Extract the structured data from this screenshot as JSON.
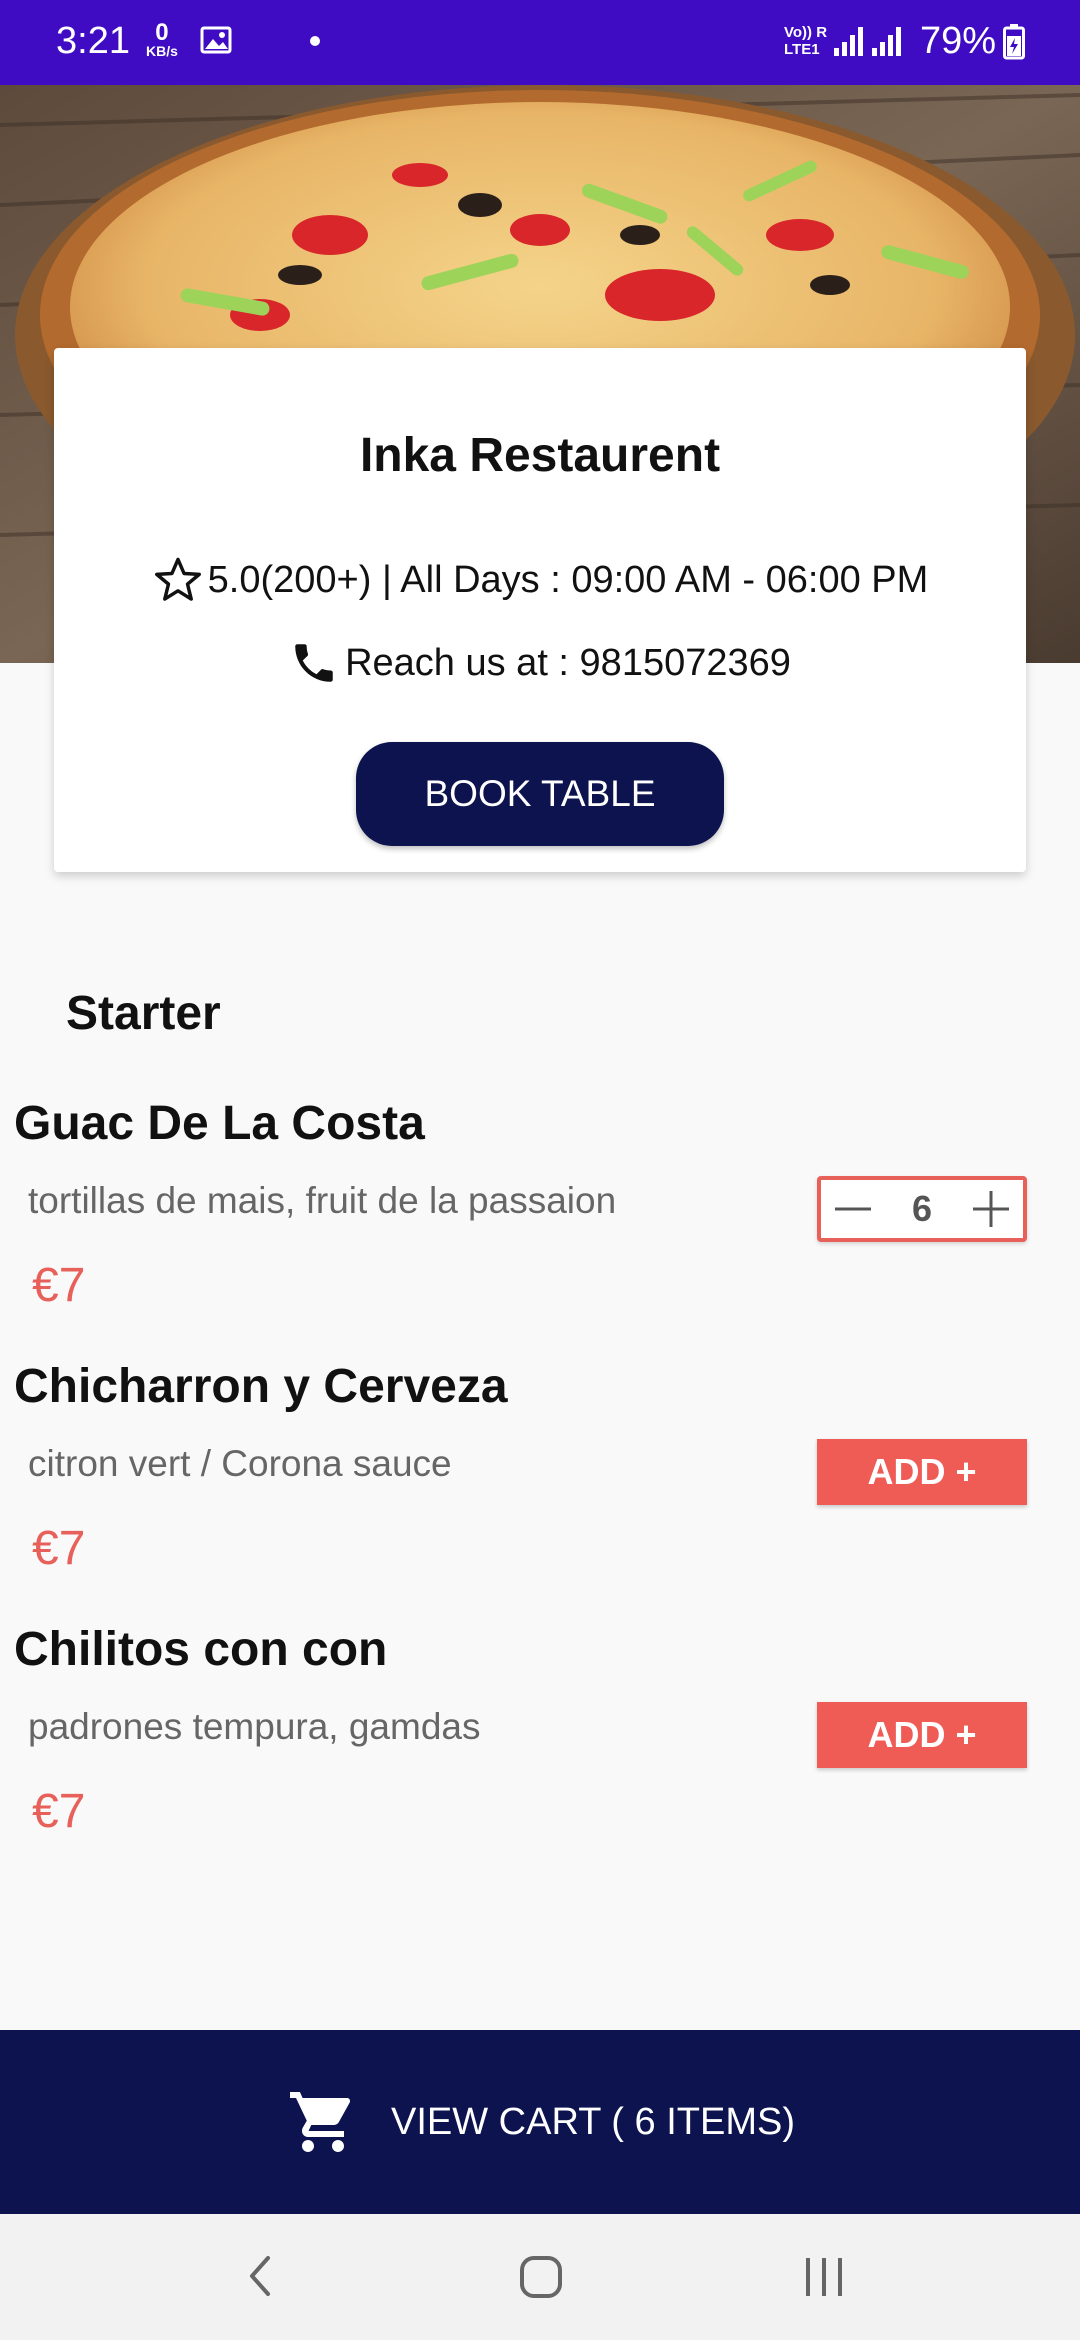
{
  "status_bar": {
    "time": "3:21",
    "net_speed_value": "0",
    "net_speed_unit": "KB/s",
    "volte_label": "Vo)) R",
    "lte_label": "LTE1",
    "battery": "79%"
  },
  "restaurant": {
    "name": "Inka Restaurent",
    "rating_hours": "5.0(200+) | All Days : 09:00 AM - 06:00 PM",
    "contact": "Reach us at : 9815072369",
    "book_button": "BOOK TABLE"
  },
  "menu": {
    "section_title": "Starter",
    "items": [
      {
        "name": "Guac De La Costa",
        "description": "tortillas de mais, fruit de la passaion",
        "price": "€7",
        "quantity": "6"
      },
      {
        "name": "Chicharron y Cerveza",
        "description": "citron vert / Corona sauce",
        "price": "€7",
        "action_label": "ADD +"
      },
      {
        "name": "Chilitos con con",
        "description": "padrones tempura, gamdas",
        "price": "€7",
        "action_label": "ADD +"
      }
    ]
  },
  "cart": {
    "label": "VIEW CART ( 6 ITEMS)"
  },
  "colors": {
    "status_bar": "#3f0cc4",
    "navy": "#0c134f",
    "accent": "#ef5c56",
    "price": "#e8605a"
  },
  "icons": [
    "image-icon",
    "signal-icon",
    "battery-icon",
    "star-icon",
    "phone-icon",
    "minus-icon",
    "plus-icon",
    "cart-icon",
    "back-icon",
    "home-icon",
    "recents-icon"
  ]
}
